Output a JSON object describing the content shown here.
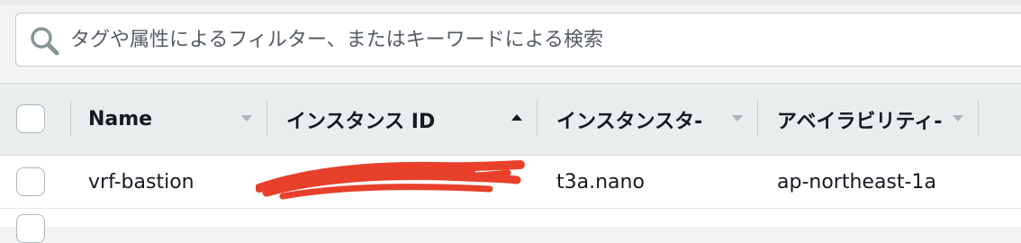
{
  "search": {
    "placeholder": "タグや属性によるフィルター、またはキーワードによる検索",
    "value": ""
  },
  "table": {
    "columns": [
      {
        "label": "Name",
        "sort": "none"
      },
      {
        "label": "インスタンス ID",
        "sort": "ascending"
      },
      {
        "label": "インスタンスタ-",
        "sort": "none"
      },
      {
        "label": "アベイラビリティ-",
        "sort": "none"
      }
    ],
    "rows": [
      {
        "name": "vrf-bastion",
        "instance_id": "",
        "instance_id_redacted": true,
        "instance_type": "t3a.nano",
        "availability_zone": "ap-northeast-1a",
        "selected": false
      }
    ]
  },
  "colors": {
    "redaction": "#e8402a",
    "header_bg": "#eaeded",
    "sort_active": "#16191f"
  }
}
